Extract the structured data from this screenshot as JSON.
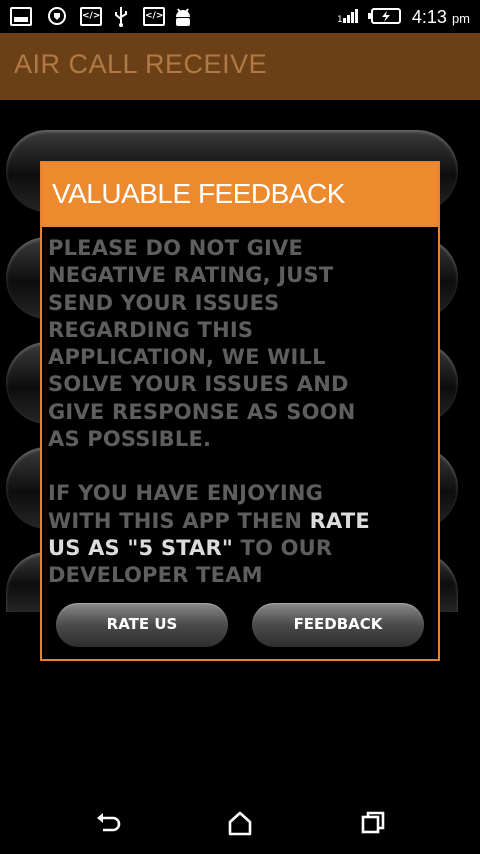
{
  "status_bar": {
    "icons": [
      "gallery-icon",
      "shield-icon",
      "code-icon",
      "usb-icon",
      "code-icon",
      "android-icon",
      "signal-icon",
      "battery-icon"
    ],
    "time": "4:13",
    "ampm": "pm"
  },
  "action_bar": {
    "title": "AIR CALL RECEIVE"
  },
  "dialog": {
    "title": "VALUABLE FEEDBACK",
    "message_lines": [
      "PLEASE DO NOT GIVE",
      "NEGATIVE RATING, JUST",
      "SEND YOUR ISSUES",
      "REGARDING THIS",
      "APPLICATION, WE WILL",
      "SOLVE YOUR ISSUES AND",
      "GIVE RESPONSE AS SOON",
      "AS POSSIBLE."
    ],
    "second_paragraph": {
      "line1": "IF YOU HAVE ENJOYING",
      "line2_pre": "WITH THIS APP THEN ",
      "line2_hl": "RATE",
      "line3_hl": "US AS \"5 STAR\"",
      "line3_post": " TO OUR",
      "line4": "DEVELOPER TEAM"
    },
    "rate_button_label": "RATE US",
    "feedback_button_label": "FEEDBACK"
  },
  "nav_bar": {
    "icons": [
      "back-icon",
      "home-icon",
      "recents-icon"
    ]
  },
  "colors": {
    "accent": "#ee8a2e",
    "action_bar": "#6b4016",
    "title_text": "#b07a45"
  }
}
